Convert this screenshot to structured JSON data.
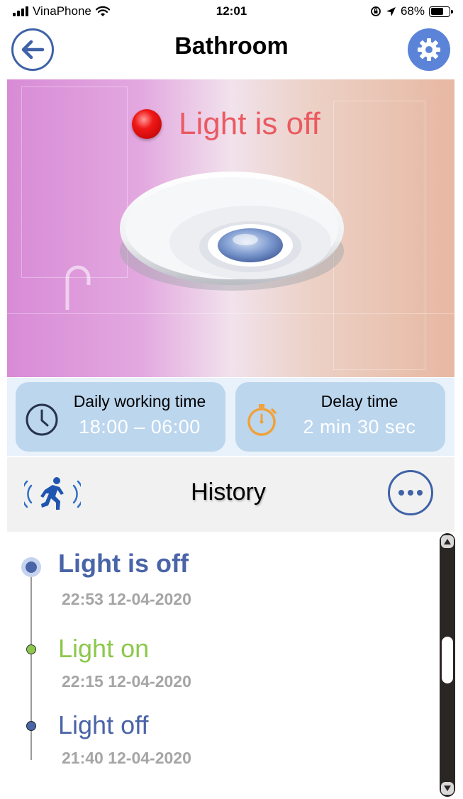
{
  "status_bar": {
    "carrier": "VinaPhone",
    "time": "12:01",
    "battery": "68%",
    "battery_level": 0.68,
    "icons": [
      "signal-icon",
      "wifi-icon",
      "orientation-lock-icon",
      "location-icon",
      "battery-icon"
    ]
  },
  "header": {
    "title": "Bathroom",
    "back_icon": "arrow-left-icon",
    "settings_icon": "gear-icon"
  },
  "hero": {
    "status_text": "Light is off",
    "status_color": "#ea5a62",
    "indicator_color": "#e01414"
  },
  "info": {
    "working_time": {
      "label": "Daily working time",
      "value": "18:00 – 06:00",
      "icon": "clock-icon"
    },
    "delay_time": {
      "label": "Delay time",
      "value": "2 min 30 sec",
      "icon": "stopwatch-icon"
    }
  },
  "history": {
    "title": "History",
    "motion_icon": "motion-sensor-icon",
    "more_icon": "more-icon",
    "items": [
      {
        "title": "Light is off",
        "time": "22:53 12-04-2020",
        "color": "#4a64a8"
      },
      {
        "title": "Light on",
        "time": "22:15 12-04-2020",
        "color": "#8cc84b"
      },
      {
        "title": "Light off",
        "time": "21:40 12-04-2020",
        "color": "#4a64a8"
      }
    ]
  },
  "colors": {
    "accent_blue": "#3f62a8",
    "settings_blue": "#5b84d8",
    "card_blue": "#bcd6ee",
    "stopwatch_orange": "#f0a23a"
  }
}
